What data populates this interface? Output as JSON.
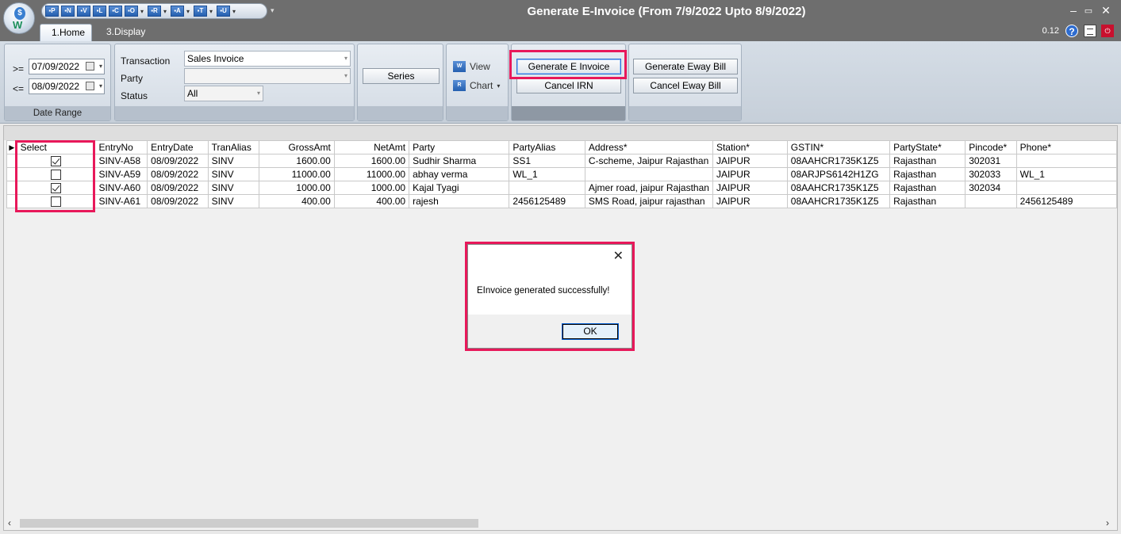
{
  "window": {
    "title": "Generate E-Invoice (From 7/9/2022 Upto 8/9/2022)",
    "version": "0.12",
    "quick_access": [
      {
        "glyph": "▪P",
        "icon": "p-icon"
      },
      {
        "glyph": "▪N",
        "icon": "n-icon"
      },
      {
        "glyph": "▪V",
        "icon": "v-icon"
      },
      {
        "glyph": "▪L",
        "icon": "l-icon"
      },
      {
        "glyph": "▪C",
        "icon": "c-icon"
      },
      {
        "glyph": "▪O",
        "icon": "o-icon"
      },
      {
        "glyph": "▪R",
        "icon": "r-icon"
      },
      {
        "glyph": "▪A",
        "icon": "a-icon"
      },
      {
        "glyph": "▪T",
        "icon": "t-icon"
      },
      {
        "glyph": "▪U",
        "icon": "u-icon"
      }
    ]
  },
  "tabs": {
    "home": "1.Home",
    "display": "3.Display"
  },
  "date_range": {
    "from_op": ">=",
    "from_value": "07/09/2022",
    "to_op": "<=",
    "to_value": "08/09/2022",
    "caption": "Date Range"
  },
  "filters": {
    "transaction_label": "Transaction",
    "transaction_value": "Sales Invoice",
    "party_label": "Party",
    "party_value": "",
    "status_label": "Status",
    "status_value": "All"
  },
  "buttons": {
    "series": "Series",
    "view": "View",
    "chart": "Chart",
    "generate_e_invoice": "Generate E Invoice",
    "cancel_irn": "Cancel IRN",
    "generate_eway_bill": "Generate Eway Bill",
    "cancel_eway_bill": "Cancel Eway Bill"
  },
  "grid": {
    "columns": [
      "Select",
      "EntryNo",
      "EntryDate",
      "TranAlias",
      "GrossAmt",
      "NetAmt",
      "Party",
      "PartyAlias",
      "Address*",
      "Station*",
      "GSTIN*",
      "PartyState*",
      "Pincode*",
      "Phone*"
    ],
    "rows": [
      {
        "selected": true,
        "entry_no": "SINV-A58",
        "entry_date": "08/09/2022",
        "tran_alias": "SINV",
        "gross_amt": "1600.00",
        "net_amt": "1600.00",
        "party": "Sudhir Sharma",
        "party_alias": "SS1",
        "address": "C-scheme, Jaipur Rajasthan",
        "station": "JAIPUR",
        "gstin": "08AAHCR1735K1Z5",
        "party_state": "Rajasthan",
        "pincode": " 302031",
        "phone": ""
      },
      {
        "selected": false,
        "entry_no": "SINV-A59",
        "entry_date": "08/09/2022",
        "tran_alias": "SINV",
        "gross_amt": "11000.00",
        "net_amt": "11000.00",
        "party": "abhay verma",
        "party_alias": "WL_1",
        "address": "",
        "station": "JAIPUR",
        "gstin": "08ARJPS6142H1ZG",
        "party_state": "Rajasthan",
        "pincode": "302033",
        "phone": "WL_1"
      },
      {
        "selected": true,
        "entry_no": "SINV-A60",
        "entry_date": "08/09/2022",
        "tran_alias": "SINV",
        "gross_amt": "1000.00",
        "net_amt": "1000.00",
        "party": "Kajal Tyagi",
        "party_alias": "",
        "address": "Ajmer road, jaipur Rajasthan",
        "station": "JAIPUR",
        "gstin": "08AAHCR1735K1Z5",
        "party_state": "Rajasthan",
        "pincode": "302034",
        "phone": ""
      },
      {
        "selected": false,
        "entry_no": "SINV-A61",
        "entry_date": "08/09/2022",
        "tran_alias": "SINV",
        "gross_amt": "400.00",
        "net_amt": "400.00",
        "party": "rajesh",
        "party_alias": "2456125489",
        "address": "SMS Road, jaipur rajasthan",
        "station": "JAIPUR",
        "gstin": "08AAHCR1735K1Z5",
        "party_state": "Rajasthan",
        "pincode": "",
        "phone": "2456125489"
      }
    ]
  },
  "dialog": {
    "message": "EInvoice generated successfully!",
    "ok": "OK",
    "close": "✕"
  },
  "colors": {
    "highlight": "#e8185a",
    "titlebar": "#6e6e6e"
  }
}
